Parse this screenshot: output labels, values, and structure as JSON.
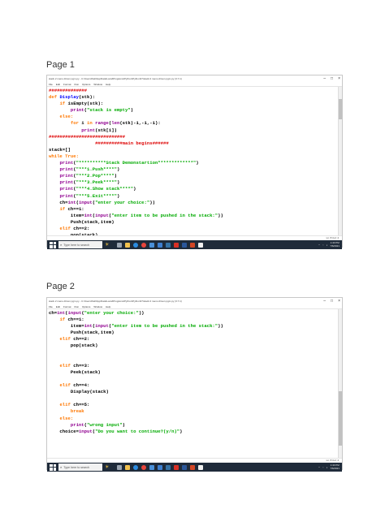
{
  "window": {
    "title": "stack 2 menu driven pgm.py - C:\\Users\\Dell\\AppData\\Local\\Programs\\Python\\Python37\\stack 2 menu driven pgm.py (3.7.1)",
    "controls": [
      "–",
      "□",
      "×"
    ]
  },
  "menu": [
    "File",
    "Edit",
    "Format",
    "Run",
    "Options",
    "Window",
    "Help"
  ],
  "status": {
    "position": "Ln: 8  Col: 4"
  },
  "taskbar": {
    "search_placeholder": "Type here to search",
    "time": "1:40 PM",
    "date": "7/6/2021"
  },
  "pages": [
    {
      "label": "Page 1",
      "lines": [
        [
          {
            "t": "##############",
            "c": "cm"
          }
        ],
        [
          {
            "t": "def ",
            "c": "kw"
          },
          {
            "t": "Display",
            "c": "fn"
          },
          {
            "t": "(stk):",
            "c": ""
          }
        ],
        [
          {
            "t": "    ",
            "c": ""
          },
          {
            "t": "if ",
            "c": "kw"
          },
          {
            "t": "isEmpty(stk):",
            "c": ""
          }
        ],
        [
          {
            "t": "        ",
            "c": ""
          },
          {
            "t": "print",
            "c": "bi"
          },
          {
            "t": "(",
            "c": ""
          },
          {
            "t": "\"stack is empty\"",
            "c": "st"
          },
          {
            "t": ")",
            "c": ""
          }
        ],
        [
          {
            "t": "    ",
            "c": ""
          },
          {
            "t": "else:",
            "c": "kw"
          }
        ],
        [
          {
            "t": "        ",
            "c": ""
          },
          {
            "t": "for ",
            "c": "kw"
          },
          {
            "t": "i ",
            "c": ""
          },
          {
            "t": "in ",
            "c": "kw"
          },
          {
            "t": "range",
            "c": "bi"
          },
          {
            "t": "(",
            "c": ""
          },
          {
            "t": "len",
            "c": "bi"
          },
          {
            "t": "(stk)-1,-1,-1):",
            "c": ""
          }
        ],
        [
          {
            "t": "            ",
            "c": ""
          },
          {
            "t": "print",
            "c": "bi"
          },
          {
            "t": "(stk[i])",
            "c": ""
          }
        ],
        [
          {
            "t": "############################",
            "c": "cm"
          }
        ],
        [
          {
            "t": "                 ",
            "c": ""
          },
          {
            "t": "##########main begins######",
            "c": "cm"
          }
        ],
        [
          {
            "t": "stack=[]",
            "c": ""
          }
        ],
        [
          {
            "t": "while ",
            "c": "kw"
          },
          {
            "t": "True:",
            "c": "kw"
          }
        ],
        [
          {
            "t": "    ",
            "c": ""
          },
          {
            "t": "print",
            "c": "bi"
          },
          {
            "t": "(",
            "c": ""
          },
          {
            "t": "\"**********Stack Demonstartion*************\"",
            "c": "st"
          },
          {
            "t": ")",
            "c": ""
          }
        ],
        [
          {
            "t": "    ",
            "c": ""
          },
          {
            "t": "print",
            "c": "bi"
          },
          {
            "t": "(",
            "c": ""
          },
          {
            "t": "\"***1.Push****\"",
            "c": "st"
          },
          {
            "t": ")",
            "c": ""
          }
        ],
        [
          {
            "t": "    ",
            "c": ""
          },
          {
            "t": "print",
            "c": "bi"
          },
          {
            "t": "(",
            "c": ""
          },
          {
            "t": "\"***2.Pop****\"",
            "c": "st"
          },
          {
            "t": ")",
            "c": ""
          }
        ],
        [
          {
            "t": "    ",
            "c": ""
          },
          {
            "t": "print",
            "c": "bi"
          },
          {
            "t": "(",
            "c": ""
          },
          {
            "t": "\"***3.Peek****\"",
            "c": "st"
          },
          {
            "t": ")",
            "c": ""
          }
        ],
        [
          {
            "t": "    ",
            "c": ""
          },
          {
            "t": "print",
            "c": "bi"
          },
          {
            "t": "(",
            "c": ""
          },
          {
            "t": "\"***4.Show stack****\"",
            "c": "st"
          },
          {
            "t": ")",
            "c": ""
          }
        ],
        [
          {
            "t": "    ",
            "c": ""
          },
          {
            "t": "print",
            "c": "bi"
          },
          {
            "t": "(",
            "c": ""
          },
          {
            "t": "\"***5.Exit****\"",
            "c": "st"
          },
          {
            "t": ")",
            "c": ""
          }
        ],
        [
          {
            "t": "    ch=",
            "c": ""
          },
          {
            "t": "int",
            "c": "bi"
          },
          {
            "t": "(",
            "c": ""
          },
          {
            "t": "input",
            "c": "bi"
          },
          {
            "t": "(",
            "c": ""
          },
          {
            "t": "\"enter your choice:\"",
            "c": "st"
          },
          {
            "t": "))",
            "c": ""
          }
        ],
        [
          {
            "t": "    ",
            "c": ""
          },
          {
            "t": "if ",
            "c": "kw"
          },
          {
            "t": "ch==1:",
            "c": ""
          }
        ],
        [
          {
            "t": "        item=",
            "c": ""
          },
          {
            "t": "int",
            "c": "bi"
          },
          {
            "t": "(",
            "c": ""
          },
          {
            "t": "input",
            "c": "bi"
          },
          {
            "t": "(",
            "c": ""
          },
          {
            "t": "\"enter item to be pushed in the stack:\"",
            "c": "st"
          },
          {
            "t": "))",
            "c": ""
          }
        ],
        [
          {
            "t": "        Push(stack,item)",
            "c": ""
          }
        ],
        [
          {
            "t": "    ",
            "c": ""
          },
          {
            "t": "elif ",
            "c": "kw"
          },
          {
            "t": "ch==2:",
            "c": ""
          }
        ],
        [
          {
            "t": "        pop(stack)",
            "c": ""
          }
        ]
      ],
      "scroll_thumb": [
        0.08,
        0.22
      ]
    },
    {
      "label": "Page 2",
      "lines": [
        [
          {
            "t": "ch=",
            "c": ""
          },
          {
            "t": "int",
            "c": "bi"
          },
          {
            "t": "(",
            "c": ""
          },
          {
            "t": "input",
            "c": "bi"
          },
          {
            "t": "(",
            "c": ""
          },
          {
            "t": "\"enter your choice:\"",
            "c": "st"
          },
          {
            "t": "))",
            "c": ""
          }
        ],
        [
          {
            "t": "    ",
            "c": ""
          },
          {
            "t": "if ",
            "c": "kw"
          },
          {
            "t": "ch==1:",
            "c": ""
          }
        ],
        [
          {
            "t": "        item=",
            "c": ""
          },
          {
            "t": "int",
            "c": "bi"
          },
          {
            "t": "(",
            "c": ""
          },
          {
            "t": "input",
            "c": "bi"
          },
          {
            "t": "(",
            "c": ""
          },
          {
            "t": "\"enter item to be pushed in the stack:\"",
            "c": "st"
          },
          {
            "t": "))",
            "c": ""
          }
        ],
        [
          {
            "t": "        Push(stack,item)",
            "c": ""
          }
        ],
        [
          {
            "t": "    ",
            "c": ""
          },
          {
            "t": "elif ",
            "c": "kw"
          },
          {
            "t": "ch==2:",
            "c": ""
          }
        ],
        [
          {
            "t": "        pop(stack)",
            "c": ""
          }
        ],
        [
          {
            "t": "",
            "c": ""
          }
        ],
        [
          {
            "t": "",
            "c": ""
          }
        ],
        [
          {
            "t": "    ",
            "c": ""
          },
          {
            "t": "elif ",
            "c": "kw"
          },
          {
            "t": "ch==3:",
            "c": ""
          }
        ],
        [
          {
            "t": "        Peek(stack)",
            "c": ""
          }
        ],
        [
          {
            "t": "",
            "c": ""
          }
        ],
        [
          {
            "t": "    ",
            "c": ""
          },
          {
            "t": "elif ",
            "c": "kw"
          },
          {
            "t": "ch==4:",
            "c": ""
          }
        ],
        [
          {
            "t": "        Display(stack)",
            "c": ""
          }
        ],
        [
          {
            "t": "",
            "c": ""
          }
        ],
        [
          {
            "t": "    ",
            "c": ""
          },
          {
            "t": "elif ",
            "c": "kw"
          },
          {
            "t": "ch==5:",
            "c": ""
          }
        ],
        [
          {
            "t": "        ",
            "c": ""
          },
          {
            "t": "break",
            "c": "kw"
          }
        ],
        [
          {
            "t": "    ",
            "c": ""
          },
          {
            "t": "else:",
            "c": "kw"
          }
        ],
        [
          {
            "t": "        ",
            "c": ""
          },
          {
            "t": "print",
            "c": "bi"
          },
          {
            "t": "(",
            "c": ""
          },
          {
            "t": "\"wrong input\"",
            "c": "st"
          },
          {
            "t": ")",
            "c": ""
          }
        ],
        [
          {
            "t": "    choice=",
            "c": ""
          },
          {
            "t": "input",
            "c": "bi"
          },
          {
            "t": "(",
            "c": ""
          },
          {
            "t": "\"Do you want to continue?(y/n)\"",
            "c": "st"
          },
          {
            "t": ")",
            "c": ""
          }
        ]
      ],
      "scroll_thumb": [
        0.55,
        0.92
      ]
    }
  ]
}
